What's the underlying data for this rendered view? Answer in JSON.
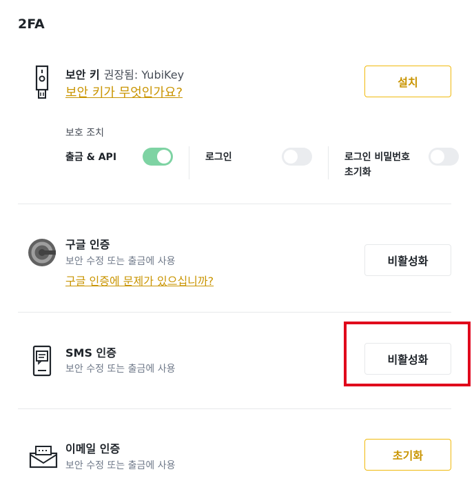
{
  "page_title": "2FA",
  "security_key": {
    "title": "보안 키",
    "recommended": "권장됨: YubiKey",
    "link": "보안 키가 무엇인가요?",
    "button": "설치",
    "protection_heading": "보호 조치",
    "protections": [
      {
        "label": "출금 & API",
        "enabled": true
      },
      {
        "label": "로그인",
        "enabled": false
      },
      {
        "label_line1": "로그인 비밀번호",
        "label_line2": "초기화",
        "enabled": false
      }
    ]
  },
  "google_auth": {
    "title": "구글 인증",
    "subtitle": "보안 수정 또는 출금에 사용",
    "link": "구글 인증에 문제가 있으십니까?",
    "button": "비활성화"
  },
  "sms_auth": {
    "title": "SMS 인증",
    "subtitle": "보안 수정 또는 출금에 사용",
    "button": "비활성화"
  },
  "email_auth": {
    "title": "이메일 인증",
    "subtitle": "보안 수정 또는 출금에 사용",
    "button": "초기화"
  },
  "colors": {
    "accent": "#f0b90b",
    "link": "#c99400",
    "toggle_on": "#7ed3a3",
    "highlight": "#e0001b"
  },
  "icons": [
    "usb-key-icon",
    "google-authenticator-icon",
    "sms-phone-icon",
    "email-envelope-icon"
  ]
}
